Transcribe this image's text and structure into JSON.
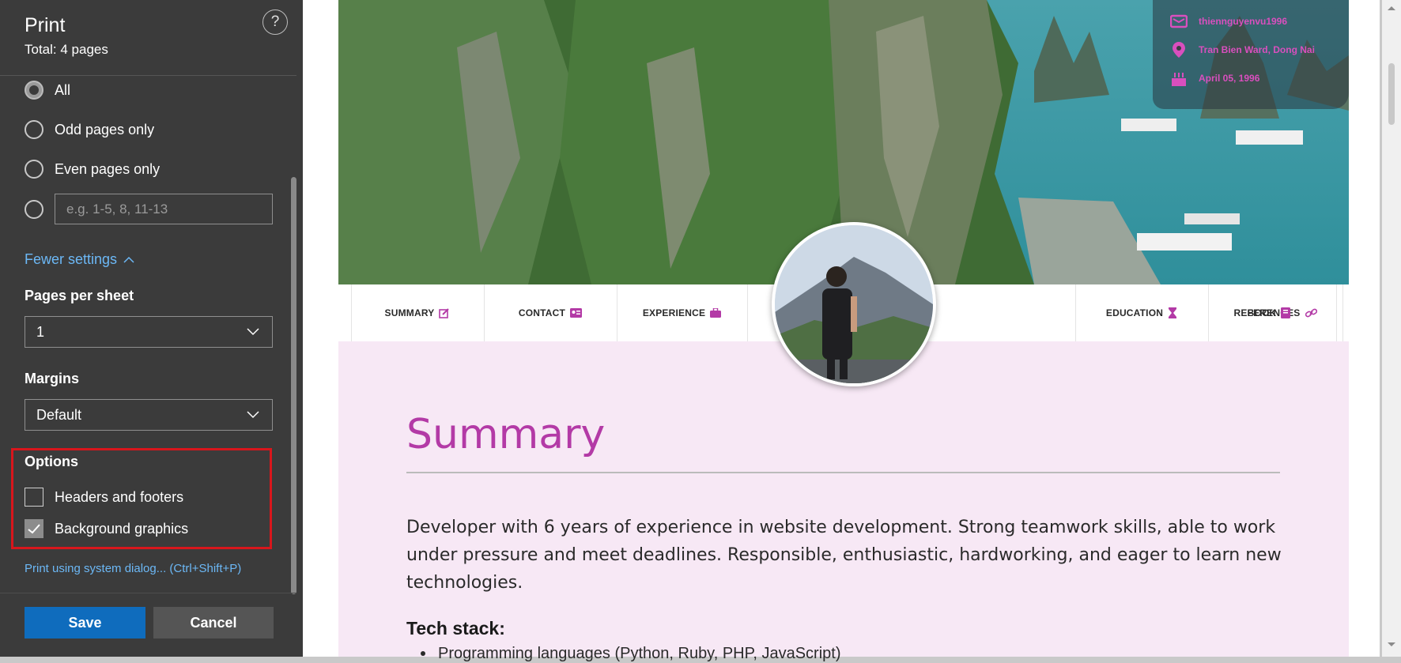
{
  "print_panel": {
    "title": "Print",
    "total": "Total: 4 pages",
    "help": "?",
    "pages": {
      "options": [
        {
          "label": "All",
          "selected": true
        },
        {
          "label": "Odd pages only",
          "selected": false
        },
        {
          "label": "Even pages only",
          "selected": false
        }
      ],
      "custom_placeholder": "e.g. 1-5, 8, 11-13"
    },
    "fewer_settings": "Fewer settings",
    "pages_per_sheet": {
      "label": "Pages per sheet",
      "value": "1"
    },
    "margins": {
      "label": "Margins",
      "value": "Default"
    },
    "options": {
      "label": "Options",
      "headers_footers": {
        "label": "Headers and footers",
        "checked": false
      },
      "background_graphics": {
        "label": "Background graphics",
        "checked": true
      }
    },
    "system_dialog": "Print using system dialog... (Ctrl+Shift+P)",
    "save": "Save",
    "cancel": "Cancel"
  },
  "preview": {
    "contact": {
      "email": "thiennguyenvu1996",
      "address": "Tran Bien Ward, Dong Nai",
      "birthday": "April 05, 1996"
    },
    "nav": [
      "SUMMARY",
      "CONTACT",
      "EXPERIENCE",
      "EDUCATION",
      "REFERENCES",
      "BOOK"
    ],
    "summary": {
      "title": "Summary",
      "text": "Developer with 6 years of experience in website development. Strong teamwork skills, able to work under pressure and meet deadlines. Responsible, enthusiastic, hardworking, and eager to learn new technologies.",
      "tech_title": "Tech stack:",
      "tech_item": "Programming languages (Python, Ruby, PHP, JavaScript)"
    },
    "accent_color": "#b33aa6"
  }
}
